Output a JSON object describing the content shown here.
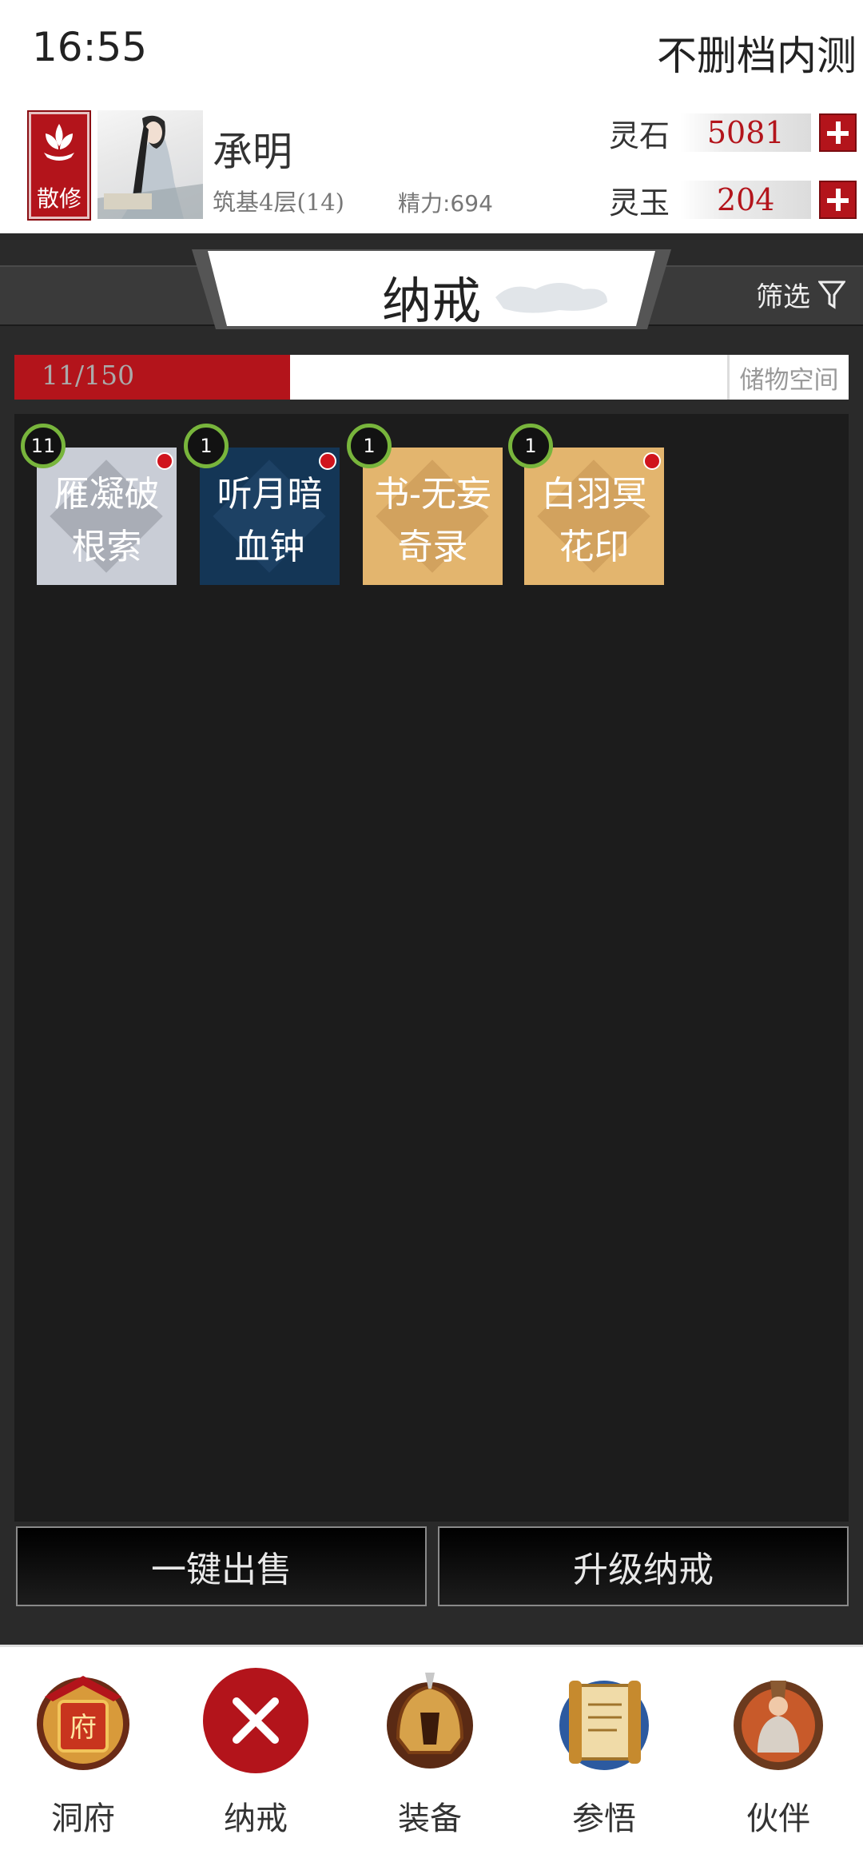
{
  "status": {
    "time": "16:55",
    "title": "不删档内测"
  },
  "player": {
    "sect_badge": "散修",
    "name": "承明",
    "realm": "筑基4层(14)",
    "energy": "精力:694"
  },
  "currencies": [
    {
      "label": "灵石",
      "value": "5081"
    },
    {
      "label": "灵玉",
      "value": "204"
    }
  ],
  "panel": {
    "tab_title": "纳戒",
    "filter_label": "筛选",
    "capacity_text": "11/150",
    "capacity_used": 11,
    "capacity_max": 150,
    "capacity_label": "储物空间"
  },
  "items": [
    {
      "line1": "雁凝破",
      "line2": "根索",
      "count": "11",
      "bg": "#c9cdd6",
      "diamond": "#a9adb6",
      "new": true
    },
    {
      "line1": "听月暗",
      "line2": "血钟",
      "count": "1",
      "bg": "#143656",
      "diamond": "#1d4164",
      "new": true
    },
    {
      "line1": "书-无妄",
      "line2": "奇录",
      "count": "1",
      "bg": "#e3b56e",
      "diamond": "#d2a25e",
      "new": false
    },
    {
      "line1": "白羽冥",
      "line2": "花印",
      "count": "1",
      "bg": "#e3b56e",
      "diamond": "#d2a25e",
      "new": true
    }
  ],
  "actions": {
    "sell_all": "一键出售",
    "upgrade": "升级纳戒"
  },
  "nav": [
    {
      "label": "洞府",
      "icon": "cave-mansion-icon"
    },
    {
      "label": "纳戒",
      "icon": "close-icon"
    },
    {
      "label": "装备",
      "icon": "helmet-icon"
    },
    {
      "label": "参悟",
      "icon": "scroll-icon"
    },
    {
      "label": "伙伴",
      "icon": "companion-icon"
    }
  ],
  "colors": {
    "accent_red": "#b3141b",
    "panel_dark": "#2a2a2a",
    "badge_green": "#78b53c"
  }
}
